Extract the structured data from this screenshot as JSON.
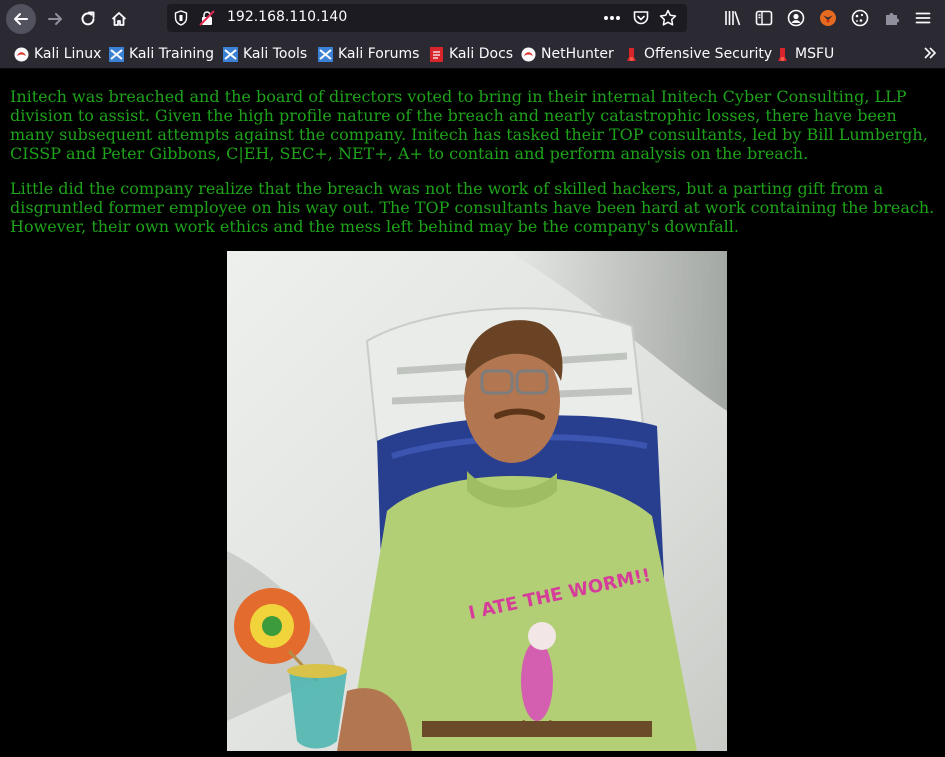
{
  "browser": {
    "url": "192.168.110.140",
    "bookmarks": [
      {
        "label": "Kali Linux",
        "icon": "kali-dragon-icon"
      },
      {
        "label": "Kali Training",
        "icon": "kali-training-icon"
      },
      {
        "label": "Kali Tools",
        "icon": "kali-tools-icon"
      },
      {
        "label": "Kali Forums",
        "icon": "kali-forums-icon"
      },
      {
        "label": "Kali Docs",
        "icon": "kali-docs-icon"
      },
      {
        "label": "NetHunter",
        "icon": "nethunter-icon"
      },
      {
        "label": "Offensive Security",
        "icon": "offsec-icon"
      },
      {
        "label": "MSFU",
        "icon": "msfu-icon"
      }
    ],
    "colors": {
      "chrome": "#2b2a33",
      "urlbar": "#1c1b22",
      "text": "#fbfbfe"
    }
  },
  "page": {
    "paragraphs": [
      "Initech was breached and the board of directors voted to bring in their internal Initech Cyber Consulting, LLP division to assist. Given the high profile nature of the breach and nearly catastrophic losses, there have been many subsequent attempts against the company. Initech has tasked their TOP consultants, led by Bill Lumbergh, CISSP and Peter Gibbons, C|EH, SEC+, NET+, A+ to contain and perform analysis on the breach.",
      "Little did the company realize that the breach was not the work of skilled hackers, but a parting gift from a disgruntled former employee on his way out. The TOP consultants have been hard at work containing the breach. However, their own work ethics and the mess left behind may be the company's downfall."
    ],
    "photo_shirt_text": "I ATE THE WORM!!",
    "colors": {
      "background": "#000000",
      "text": "#1ea31a"
    }
  }
}
